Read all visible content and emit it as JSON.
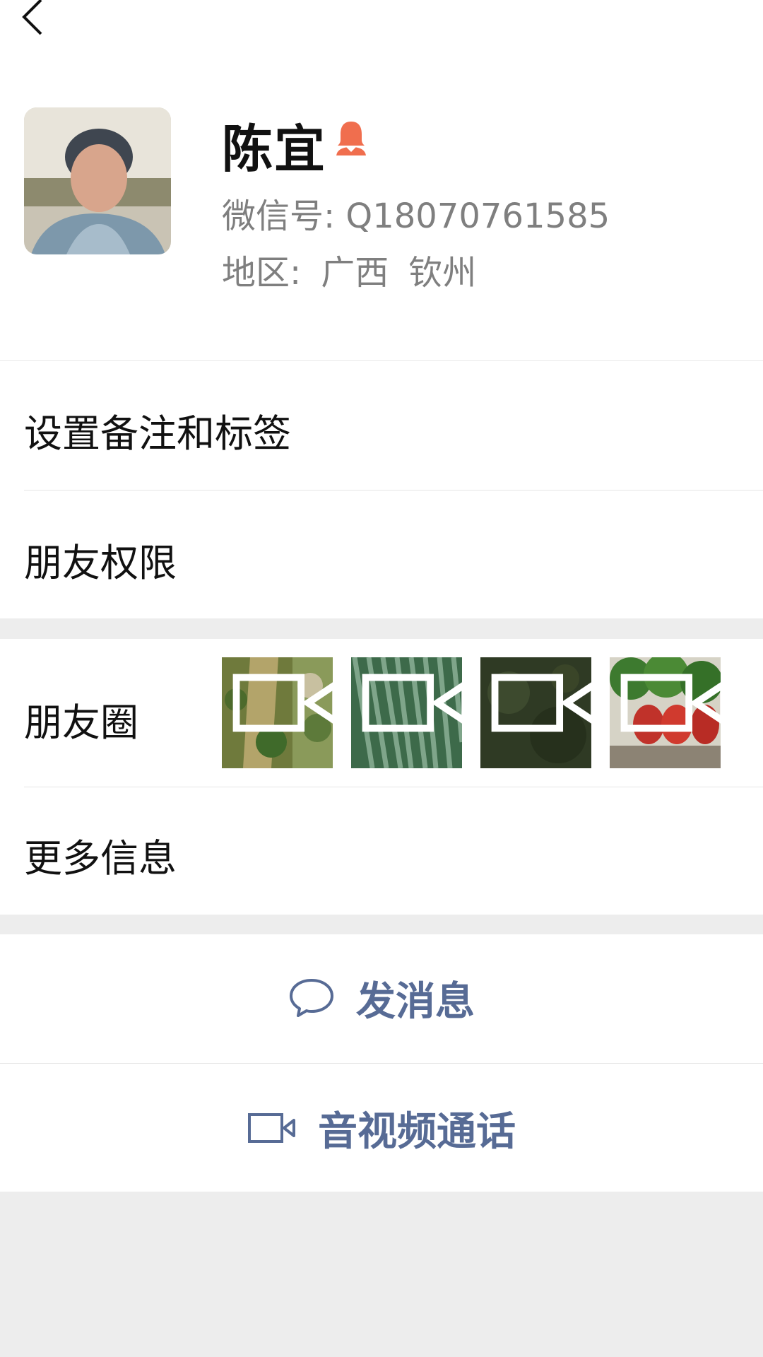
{
  "header": {
    "back_icon": "chevron-left-icon"
  },
  "profile": {
    "name": "陈宜",
    "gender_icon": "female-person-icon",
    "gender_color": "#f06e4e",
    "wechat_id": "微信号: Q18070761585",
    "region_label": "地区:",
    "region_province": "广西",
    "region_city": "钦州"
  },
  "menu": {
    "set_remark_tags": "设置备注和标签",
    "friend_permissions": "朋友权限",
    "moments": "朋友圈",
    "more_info": "更多信息"
  },
  "moments_thumbs": [
    {
      "name": "moment-thumb-1",
      "video_icon": "video-camera-icon"
    },
    {
      "name": "moment-thumb-2",
      "video_icon": "video-camera-icon"
    },
    {
      "name": "moment-thumb-3",
      "video_icon": "video-camera-icon"
    },
    {
      "name": "moment-thumb-4",
      "video_icon": "video-camera-icon"
    }
  ],
  "actions": {
    "send_message": "发消息",
    "video_call": "音视频通话",
    "accent_color": "#576b95"
  }
}
